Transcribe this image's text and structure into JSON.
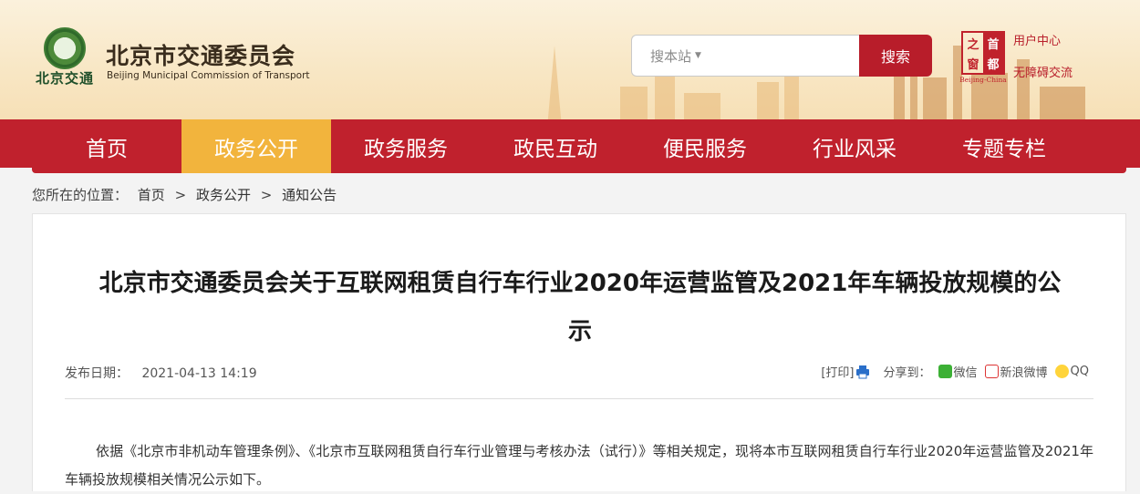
{
  "header": {
    "logo_text": "北京交通",
    "site_name": "北京市交通委员会",
    "site_name_en": "Beijing Municipal Commission of Transport",
    "search_placeholder": "搜本站",
    "search_button": "搜索",
    "capital_badge": {
      "chars": [
        "之",
        "首",
        "窗",
        "都"
      ],
      "caption": "Beijing-China"
    },
    "user_center": "用户中心",
    "accessibility": "无障碍交流"
  },
  "nav": {
    "items": [
      {
        "label": "首页"
      },
      {
        "label": "政务公开"
      },
      {
        "label": "政务服务"
      },
      {
        "label": "政民互动"
      },
      {
        "label": "便民服务"
      },
      {
        "label": "行业风采"
      },
      {
        "label": "专题专栏"
      }
    ],
    "active_index": 1
  },
  "breadcrumb": {
    "prefix": "您所在的位置：",
    "items": [
      "首页",
      "政务公开",
      "通知公告"
    ],
    "separator": ">"
  },
  "article": {
    "title": "北京市交通委员会关于互联网租赁自行车行业2020年运营监管及2021年车辆投放规模的公示",
    "date_label": "发布日期：",
    "date_value": "2021-04-13 14:19",
    "print_label": "[打印]",
    "share_label": "分享到：",
    "share_wechat": "微信",
    "share_weibo": "新浪微博",
    "share_qq": "QQ",
    "body": "依据《北京市非机动车管理条例》、《北京市互联网租赁自行车行业管理与考核办法（试行）》等相关规定，现将本市互联网租赁自行车行业2020年运营监管及2021年车辆投放规模相关情况公示如下。"
  },
  "colors": {
    "nav_red": "#c0212d",
    "nav_active": "#f2b43d",
    "search_button": "#b81d2a",
    "header_bg": "#f8e6c3"
  }
}
